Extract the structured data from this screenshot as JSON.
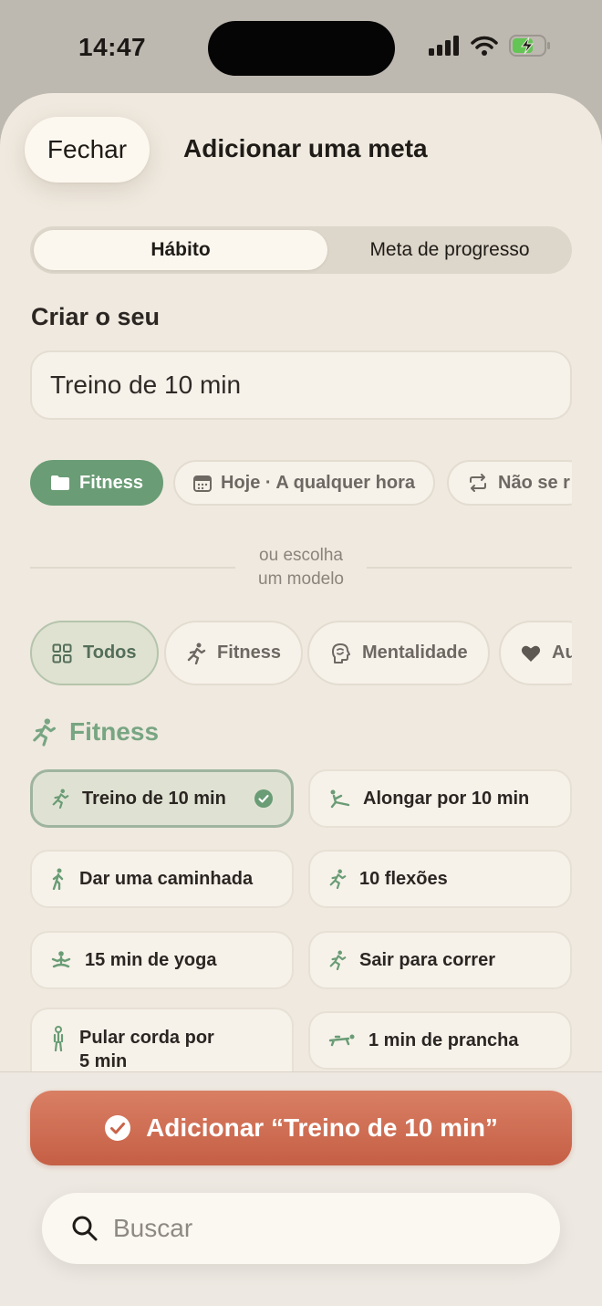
{
  "status_bar": {
    "time": "14:47"
  },
  "header": {
    "close_label": "Fechar",
    "title": "Adicionar uma meta"
  },
  "segmented": {
    "habit": "Hábito",
    "progress": "Meta de progresso"
  },
  "create": {
    "title": "Criar o seu",
    "name_value": "Treino de 10 min",
    "chips": [
      {
        "label": "Fitness",
        "icon": "folder-icon"
      },
      {
        "label": "Hoje · A qualquer hora",
        "icon": "calendar-icon"
      },
      {
        "label": "Não se r",
        "icon": "repeat-icon"
      }
    ]
  },
  "divider": {
    "line1": "ou escolha",
    "line2": "um modelo"
  },
  "filters": [
    {
      "label": "Todos",
      "icon": "grid-icon"
    },
    {
      "label": "Fitness",
      "icon": "runner-icon"
    },
    {
      "label": "Mentalidade",
      "icon": "brain-icon"
    },
    {
      "label": "Au",
      "icon": "heart-icon"
    }
  ],
  "category": {
    "title": "Fitness",
    "icon": "runner-icon"
  },
  "templates": [
    {
      "label": "Treino de 10 min",
      "selected": true
    },
    {
      "label": "Alongar por 10 min"
    },
    {
      "label": "Dar uma caminhada"
    },
    {
      "label": "10 flexões"
    },
    {
      "label": "15 min de yoga"
    },
    {
      "label": "Sair para correr"
    },
    {
      "label": "Pular corda por\n5 min"
    },
    {
      "label": "1 min de prancha"
    }
  ],
  "footer": {
    "add_label": "Adicionar “Treino de 10 min”",
    "search_placeholder": "Buscar"
  },
  "colors": {
    "accent_green": "#6a9c75",
    "add_button": "#c96448",
    "sheet_bg": "#efe9df"
  }
}
